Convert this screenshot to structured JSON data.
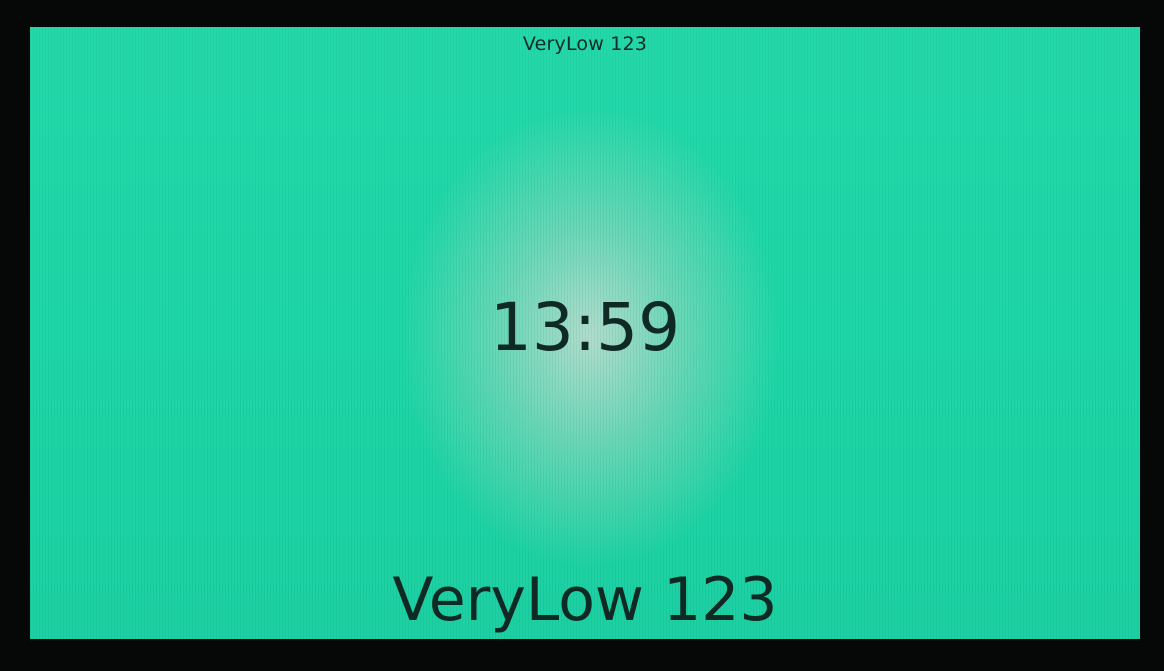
{
  "display": {
    "header_text": "VeryLow 123",
    "time": "13:59",
    "footer_text": "VeryLow 123",
    "background_color": "#1ad6a6",
    "text_color": "#0f2a24",
    "bezel_color": "#060707"
  }
}
